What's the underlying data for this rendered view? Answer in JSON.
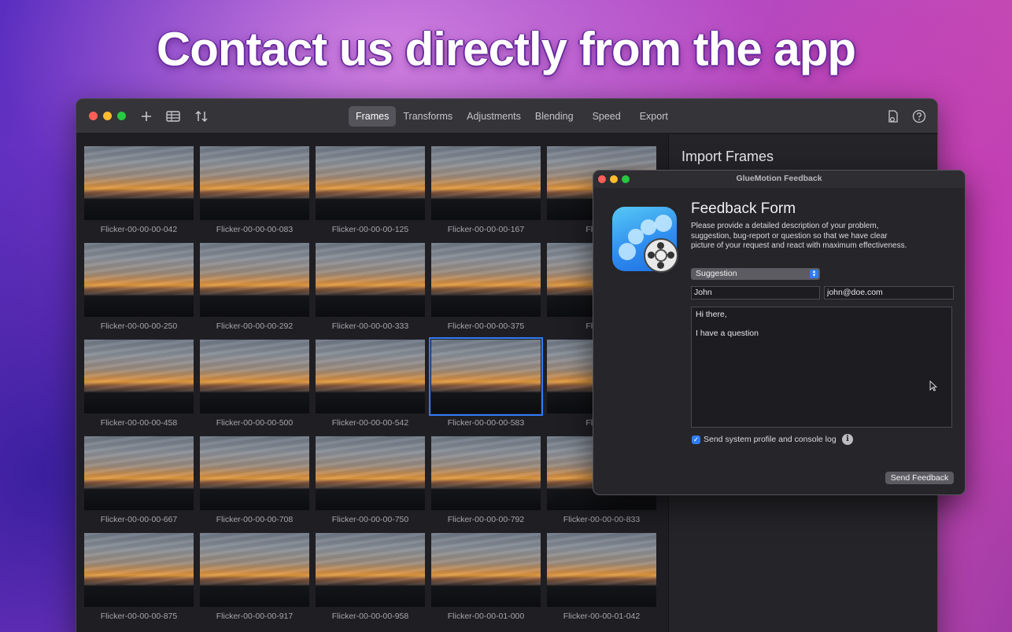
{
  "headline": "Contact us directly from the app",
  "main_window": {
    "tabs": [
      {
        "label": "Frames",
        "active": true
      },
      {
        "label": "Transforms",
        "active": false
      },
      {
        "label": "Adjustments",
        "active": false
      },
      {
        "label": "Blending",
        "active": false
      },
      {
        "label": "Speed",
        "active": false
      },
      {
        "label": "Export",
        "active": false
      }
    ],
    "toolbar_icons": [
      "add-icon",
      "table-icon",
      "sort-icon",
      "document-gear-icon",
      "help-icon"
    ],
    "frames": [
      [
        "Flicker-00-00-00-042",
        "Flicker-00-00-00-083",
        "Flicker-00-00-00-125",
        "Flicker-00-00-00-167",
        "Flicker-0"
      ],
      [
        "Flicker-00-00-00-250",
        "Flicker-00-00-00-292",
        "Flicker-00-00-00-333",
        "Flicker-00-00-00-375",
        "Flicker-0"
      ],
      [
        "Flicker-00-00-00-458",
        "Flicker-00-00-00-500",
        "Flicker-00-00-00-542",
        "Flicker-00-00-00-583",
        "Flicker-0"
      ],
      [
        "Flicker-00-00-00-667",
        "Flicker-00-00-00-708",
        "Flicker-00-00-00-750",
        "Flicker-00-00-00-792",
        "Flicker-00-00-00-833"
      ],
      [
        "Flicker-00-00-00-875",
        "Flicker-00-00-00-917",
        "Flicker-00-00-00-958",
        "Flicker-00-00-01-000",
        "Flicker-00-00-01-042"
      ]
    ],
    "selected_frame": "Flicker-00-00-00-583",
    "side_panel_title": "Import Frames"
  },
  "feedback_window": {
    "title": "GlueMotion Feedback",
    "heading": "Feedback Form",
    "description": "Please provide a detailed description of your problem, suggestion, bug-report or question so that we have clear picture of your request and react with maximum effectiveness.",
    "category_value": "Suggestion",
    "name_value": "John",
    "email_value": "john@doe.com",
    "message_lines": [
      "Hi there,",
      "",
      "I have a question"
    ],
    "send_profile_label": "Send system profile and console log",
    "send_profile_checked": true,
    "send_button": "Send Feedback"
  },
  "colors": {
    "accent": "#2f7cf6",
    "window_bg": "#1e1d22",
    "toolbar_bg": "#353439"
  }
}
